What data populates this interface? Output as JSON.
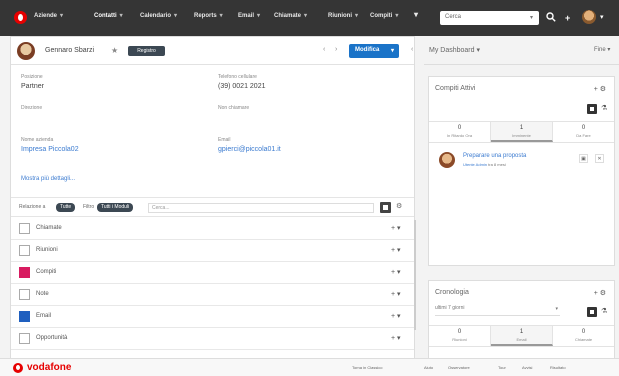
{
  "nav": {
    "items": [
      {
        "label": "Aziende",
        "caret": "▾"
      },
      {
        "label": "Contatti",
        "caret": "▾"
      },
      {
        "label": "Calendario",
        "caret": "▾"
      },
      {
        "label": "Reports",
        "caret": "▾"
      },
      {
        "label": "Email",
        "caret": "▾"
      },
      {
        "label": "Chiamate",
        "caret": "▾"
      },
      {
        "label": "Riunioni",
        "caret": "▾"
      },
      {
        "label": "Compiti",
        "caret": "▾"
      }
    ],
    "more": "▾",
    "search_placeholder": "Cerca",
    "search_caret": "▾",
    "search_icon": "search-icon",
    "plus": "+",
    "avatar_caret": "▾"
  },
  "record": {
    "name": "Gennaro Sbarzi",
    "star": "★",
    "chip": "Registro",
    "prev": "‹",
    "next": "›",
    "edit_label": "Modifica",
    "edit_caret": "▾",
    "more": "‹",
    "fields": [
      {
        "label": "Posizione",
        "value": "Partner"
      },
      {
        "label": "Telefono cellulare",
        "value": "(39) 0021 2021"
      },
      {
        "label": "Direzione",
        "value": ""
      },
      {
        "label": "Non chiamare",
        "value": ""
      },
      {
        "label": "Nome azienda",
        "value": "Impresa Piccola02"
      },
      {
        "label": "Email",
        "value": "gpierci@piccola01.it"
      }
    ],
    "show_more": "Mostra più dettagli..."
  },
  "subpanels": {
    "related_label": "Relazione a",
    "related_pill": "Tutte",
    "filter_label": "Filtro",
    "filter_pill": "Tutti i Moduli",
    "search_placeholder": "Cerca...",
    "rows": [
      {
        "label": "Chiamate",
        "icon": "calls-icon"
      },
      {
        "label": "Riunioni",
        "icon": "meetings-icon"
      },
      {
        "label": "Compiti",
        "icon": "tasks-icon"
      },
      {
        "label": "Note",
        "icon": "notes-icon"
      },
      {
        "label": "Email",
        "icon": "email-icon"
      },
      {
        "label": "Opportunità",
        "icon": "opportunities-icon"
      }
    ],
    "row_actions": "+ ▾"
  },
  "dashboard": {
    "title": "My Dashboard ▾",
    "done": "Fine ▾",
    "tasks": {
      "title": "Compiti Attivi",
      "icons": "+ ⚙",
      "tabs": [
        {
          "count": "0",
          "label": "In Ritardo Ora"
        },
        {
          "count": "1",
          "label": "Imminente"
        },
        {
          "count": "0",
          "label": "Da Fare"
        }
      ],
      "item_title": "Preparare una proposta",
      "item_user": "Utente Admin",
      "item_when": "tra 8 mesi"
    },
    "agenda": {
      "title": "Cronologia",
      "icons": "+ ⚙",
      "select": "ultimi 7 giorni",
      "select_caret": "▾",
      "tabs": [
        {
          "count": "0",
          "label": "Riunioni"
        },
        {
          "count": "1",
          "label": "Email"
        },
        {
          "count": "0",
          "label": "Chiamate"
        }
      ]
    }
  },
  "footer": {
    "brand": "vodafone",
    "links": [
      "Torna in Classico",
      "Aiuto",
      "Osservatore",
      "Tour",
      "Avvisi",
      "Risultato"
    ]
  }
}
